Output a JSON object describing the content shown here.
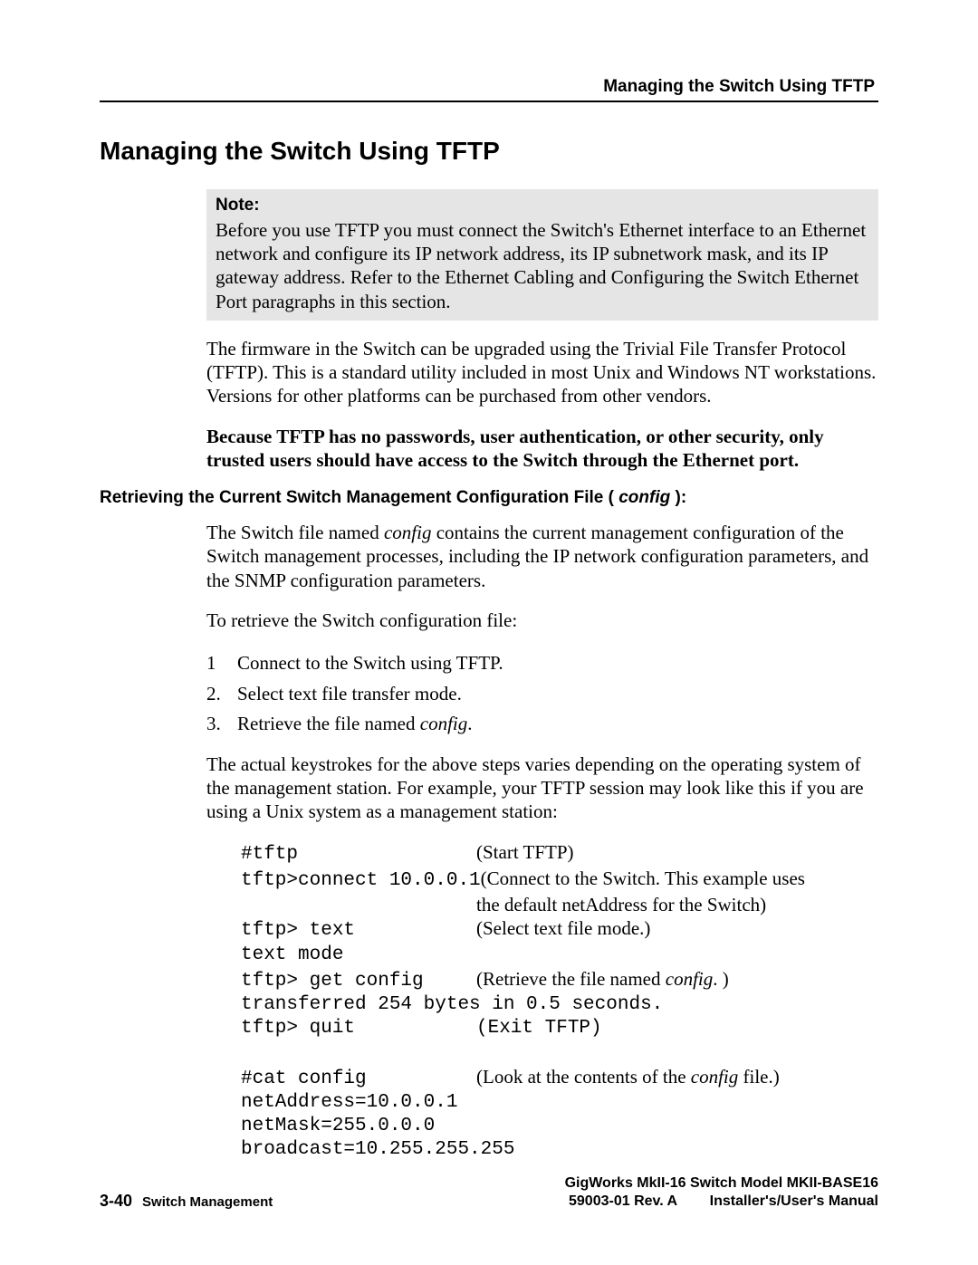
{
  "running_head": "Managing the Switch Using TFTP",
  "h1": "Managing the Switch Using TFTP",
  "note": {
    "label": "Note:",
    "text": "Before you use TFTP you must connect the Switch's Ethernet interface to an Ethernet network and configure its IP network address, its IP subnetwork mask, and its IP gateway address. Refer to the Ethernet Cabling and Configuring the Switch Ethernet Port paragraphs in this section."
  },
  "para1": "The firmware in the Switch can be upgraded using the Trivial File Transfer Protocol (TFTP).  This is a standard utility included in most Unix and Windows NT workstations.  Versions for other platforms can be purchased from other vendors.",
  "para2_bold": "Because TFTP has no passwords, user authentication, or other security, only trusted users should have access to the Switch through the Ethernet port.",
  "h2": {
    "pre": "Retrieving the Current Switch Management Configuration File (",
    "ital": " config ",
    "post": "):"
  },
  "para3": {
    "pre": "The Switch file named ",
    "ital": "config",
    "post": "  contains the current management configuration of the Switch management processes, including the IP network configuration parameters, and the SNMP configuration parameters."
  },
  "para4": "To retrieve the Switch configuration file:",
  "list": [
    {
      "num": "1",
      "text": "Connect to the Switch using TFTP."
    },
    {
      "num": "2.",
      "text": "Select text file transfer mode."
    },
    {
      "num": "3.",
      "pre": "Retrieve the file named ",
      "ital": "config",
      "post": "."
    }
  ],
  "para5": "The actual keystrokes for the above steps varies depending on the operating system of the management station.  For example, your TFTP session may look like this if you are using a Unix system as a management station:",
  "session": {
    "r1": {
      "cmd": "#tftp",
      "desc": "(Start TFTP)"
    },
    "r2": {
      "cmd": "tftp>connect 10.0.0.1",
      "desc": "(Connect to the Switch. This example uses"
    },
    "r2b": {
      "cmd": "",
      "desc": "the default netAddress for the Switch)"
    },
    "r3": {
      "cmd": "tftp> text",
      "desc": "(Select text file mode.)"
    },
    "r4": {
      "full": "text mode"
    },
    "r5": {
      "cmd": "tftp> get config",
      "desc_pre": "(Retrieve the file named ",
      "desc_ital": "config",
      "desc_post": ".  )"
    },
    "r6": {
      "full": "transferred 254 bytes in 0.5 seconds."
    },
    "r7": {
      "cmd": "tftp> quit",
      "full_desc": "(Exit TFTP)"
    },
    "r8": {
      "cmd": "#cat config",
      "desc_pre": "(Look at the contents of the ",
      "desc_ital": "config",
      "desc_post": "  file.)"
    },
    "r9": {
      "full": "netAddress=10.0.0.1"
    },
    "r10": {
      "full": "netMask=255.0.0.0"
    },
    "r11": {
      "full": "broadcast=10.255.255.255"
    }
  },
  "footer": {
    "left_page": "3-40",
    "left_section": "Switch Management",
    "right_line1": "GigWorks MkII-16 Switch Model MKII-BASE16",
    "right_line2a": "59003-01 Rev. A",
    "right_line2b": "Installer's/User's Manual"
  }
}
